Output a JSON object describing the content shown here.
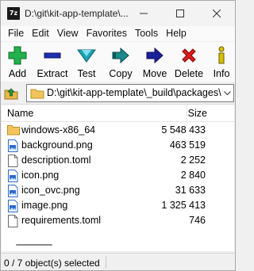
{
  "window": {
    "title": "D:\\git\\kit-app-template\\...",
    "controls": [
      "minimize",
      "maximize",
      "close"
    ]
  },
  "menu": [
    "File",
    "Edit",
    "View",
    "Favorites",
    "Tools",
    "Help"
  ],
  "toolbar": [
    {
      "label": "Add",
      "icon": "add-icon",
      "color": "#22b14c"
    },
    {
      "label": "Extract",
      "icon": "extract-icon",
      "color": "#1f2fb0"
    },
    {
      "label": "Test",
      "icon": "test-icon",
      "color": "#1aa3b8"
    },
    {
      "label": "Copy",
      "icon": "copy-icon",
      "color": "#1a8a8a"
    },
    {
      "label": "Move",
      "icon": "move-icon",
      "color": "#1a1f9a"
    },
    {
      "label": "Delete",
      "icon": "delete-icon",
      "color": "#e01b1b"
    },
    {
      "label": "Info",
      "icon": "info-icon",
      "color": "#d8c000"
    }
  ],
  "address": {
    "path": "D:\\git\\kit-app-template\\_build\\packages\\"
  },
  "columns": {
    "name": "Name",
    "size": "Size"
  },
  "files": [
    {
      "name": "windows-x86_64",
      "size": "5 548 433",
      "type": "folder"
    },
    {
      "name": "background.png",
      "size": "463 519",
      "type": "image"
    },
    {
      "name": "description.toml",
      "size": "2 252",
      "type": "text"
    },
    {
      "name": "icon.png",
      "size": "2 840",
      "type": "image"
    },
    {
      "name": "icon_ovc.png",
      "size": "31 633",
      "type": "image"
    },
    {
      "name": "image.png",
      "size": "1 325 413",
      "type": "image"
    },
    {
      "name": "requirements.toml",
      "size": "746",
      "type": "text"
    }
  ],
  "status": {
    "selection": "0 / 7 object(s) selected"
  }
}
